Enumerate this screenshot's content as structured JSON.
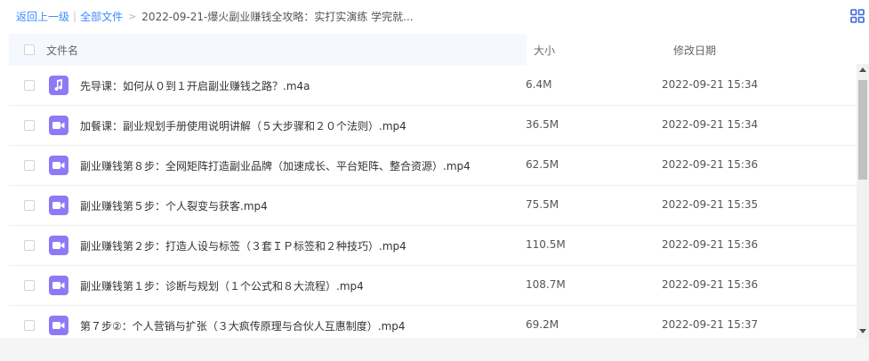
{
  "breadcrumb": {
    "back": "返回上一级",
    "separator": "|",
    "all_files": "全部文件",
    "arrow": ">",
    "current": "2022-09-21-爆火副业赚钱全攻略：实打实演练 学完就..."
  },
  "header": {
    "name": "文件名",
    "size": "大小",
    "date": "修改日期"
  },
  "files": [
    {
      "name": "先导课：如何从０到１开启副业赚钱之路？.m4a",
      "size": "6.4M",
      "date": "2022-09-21 15:34",
      "icon": "audio-file-icon"
    },
    {
      "name": "加餐课：副业规划手册使用说明讲解（５大步骤和２０个法则）.mp4",
      "size": "36.5M",
      "date": "2022-09-21 15:34",
      "icon": "video-file-icon"
    },
    {
      "name": "副业赚钱第８步：全网矩阵打造副业品牌（加速成长、平台矩阵、整合资源）.mp4",
      "size": "62.5M",
      "date": "2022-09-21 15:36",
      "icon": "video-file-icon"
    },
    {
      "name": "副业赚钱第５步：个人裂变与获客.mp4",
      "size": "75.5M",
      "date": "2022-09-21 15:35",
      "icon": "video-file-icon"
    },
    {
      "name": "副业赚钱第２步：打造人设与标签（３套ＩＰ标签和２种技巧）.mp4",
      "size": "110.5M",
      "date": "2022-09-21 15:36",
      "icon": "video-file-icon"
    },
    {
      "name": "副业赚钱第１步：诊断与规划（１个公式和８大流程）.mp4",
      "size": "108.7M",
      "date": "2022-09-21 15:36",
      "icon": "video-file-icon"
    },
    {
      "name": "第７步②：个人营销与扩张（３大疯传原理与合伙人互惠制度）.mp4",
      "size": "69.2M",
      "date": "2022-09-21 15:37",
      "icon": "video-file-icon"
    }
  ],
  "colors": {
    "link": "#3b8cff",
    "file_icon": "#8c7af7",
    "header_bg": "#f5f9ff"
  }
}
